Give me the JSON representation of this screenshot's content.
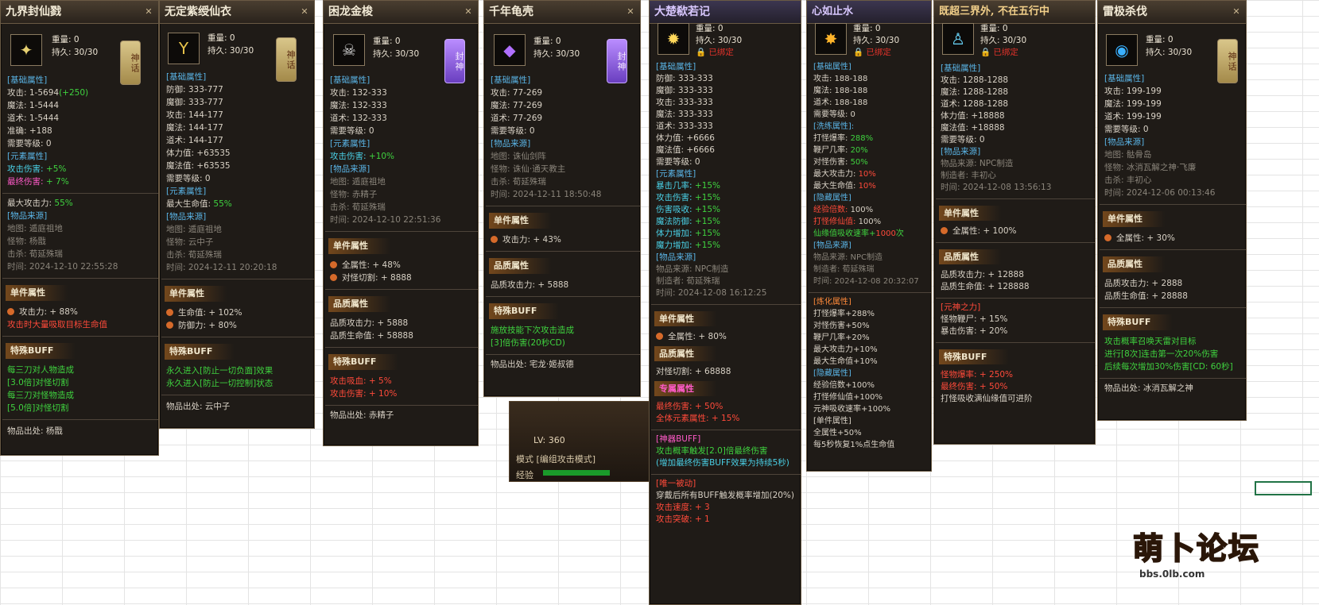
{
  "game": {
    "level": "LV: 360",
    "mode_label": "模式",
    "mode_value": "[编组攻击模式]",
    "exp_label": "经验"
  },
  "colors": {
    "panel_bg": "#1f1b17",
    "section": "#5ab4e6",
    "green": "#3fd23f",
    "red": "#ff4a3a",
    "magenta": "#ff5ac8"
  },
  "panels": [
    {
      "title": "九界封仙戮",
      "seal": "神话",
      "icon": "sword-icon",
      "weight": "重量: 0",
      "durability": "持久: 30/30",
      "lines": [
        [
          "[基础属性]"
        ],
        [
          "攻击: 1-5694",
          "(+250)"
        ],
        [
          "魔法: 1-5444"
        ],
        [
          "道术: 1-5444"
        ],
        [
          "准确: +188"
        ],
        [
          "需要等级: 0"
        ],
        [
          "[元素属性]"
        ],
        [
          "攻击伤害:",
          "+5%"
        ],
        [
          "最终伤害:",
          "+ 7%"
        ],
        [
          "最大攻击力:",
          "55%"
        ],
        [
          "[物品来源]"
        ],
        [
          "地图: 遁庭祖地"
        ],
        [
          "怪物: 杨戬"
        ],
        [
          "击杀: 荀延殊瑞"
        ],
        [
          "时间: 2024-12-10 22:55:28"
        ]
      ],
      "single_title": "单件属性",
      "single": [
        "攻击力: + 88%",
        "攻击时大量吸取目标生命值"
      ],
      "buff_title": "特殊BUFF",
      "buff": [
        "每三刀对人物造成",
        "[3.0倍]对怪切割",
        "每三刀对怪物造成",
        "[5.0倍]对怪切割"
      ],
      "source": "物品出处: 杨戬"
    },
    {
      "title": "无定紫绶仙衣",
      "seal": "神话",
      "icon": "robe-icon",
      "weight": "重量: 0",
      "durability": "持久: 30/30",
      "lines": [
        [
          "[基础属性]"
        ],
        [
          "防御: 333-777"
        ],
        [
          "魔御: 333-777"
        ],
        [
          "攻击: 144-177"
        ],
        [
          "魔法: 144-177"
        ],
        [
          "道术: 144-177"
        ],
        [
          "体力值: +63535"
        ],
        [
          "魔法值: +63535"
        ],
        [
          "需要等级: 0"
        ],
        [
          "[元素属性]"
        ],
        [
          "最大生命值:",
          "55%"
        ],
        [
          "[物品来源]"
        ],
        [
          "地图: 遁庭祖地"
        ],
        [
          "怪物: 云中子"
        ],
        [
          "击杀: 荀延殊瑞"
        ],
        [
          "时间: 2024-12-11 20:20:18"
        ]
      ],
      "single_title": "单件属性",
      "single": [
        "生命值: + 102%",
        "防御力: + 80%"
      ],
      "buff_title": "特殊BUFF",
      "buff": [
        "永久进入[防止一切负面]效果",
        "永久进入[防止一切控制]状态"
      ],
      "source": "物品出处: 云中子"
    },
    {
      "title": "困龙金梭",
      "seal": "封神",
      "icon": "skull-icon",
      "weight": "重量: 0",
      "durability": "持久: 30/30",
      "lines": [
        [
          "[基础属性]"
        ],
        [
          "攻击: 132-333"
        ],
        [
          "魔法: 132-333"
        ],
        [
          "道术: 132-333"
        ],
        [
          "需要等级: 0"
        ],
        [
          "[元素属性]"
        ],
        [
          "攻击伤害:",
          "+10%"
        ],
        [
          "[物品来源]"
        ],
        [
          "地图: 遁庭祖地"
        ],
        [
          "怪物: 赤精子"
        ],
        [
          "击杀: 荀延殊瑞"
        ],
        [
          "时间: 2024-12-10 22:51:36"
        ]
      ],
      "single_title": "单件属性",
      "single": [
        "全属性: + 48%",
        "对怪切割: + 8888"
      ],
      "quality_title": "品质属性",
      "quality": [
        "品质攻击力: + 5888",
        "品质生命值: + 58888"
      ],
      "buff_title": "特殊BUFF",
      "buff": [
        "攻击吸血: + 5%",
        "攻击伤害: + 10%"
      ],
      "source": "物品出处: 赤精子"
    },
    {
      "title": "千年龟壳",
      "seal": "封神",
      "icon": "shell-icon",
      "weight": "重量: 0",
      "durability": "持久: 30/30",
      "lines": [
        [
          "[基础属性]"
        ],
        [
          "攻击: 77-269"
        ],
        [
          "魔法: 77-269"
        ],
        [
          "道术: 77-269"
        ],
        [
          "需要等级: 0"
        ],
        [
          "[物品来源]"
        ],
        [
          "地图: 诛仙剑阵"
        ],
        [
          "怪物: 诛仙·通天教主"
        ],
        [
          "击杀: 荀延殊瑞"
        ],
        [
          "时间: 2024-12-11 18:50:48"
        ]
      ],
      "single_title": "单件属性",
      "single": [
        "攻击力: + 43%"
      ],
      "quality_title": "品质属性",
      "quality": [
        "品质攻击力: + 5888"
      ],
      "buff_title": "特殊BUFF",
      "buff": [
        "施放技能下次攻击造成",
        "[3]倍伤害(20秒CD)"
      ],
      "source": "物品出处: 宅龙·姬叔德"
    },
    {
      "title": "大楚欷若记",
      "icon": "sun-icon",
      "weight": "重量: 0",
      "durability": "持久: 30/30",
      "bound": "已绑定",
      "lines": [
        [
          "[基础属性]"
        ],
        [
          "防御: 333-333"
        ],
        [
          "魔御: 333-333"
        ],
        [
          "攻击: 333-333"
        ],
        [
          "魔法: 333-333"
        ],
        [
          "道术: 333-333"
        ],
        [
          "体力值: +6666"
        ],
        [
          "魔法值: +6666"
        ],
        [
          "需要等级: 0"
        ],
        [
          "[元素属性]"
        ],
        [
          "暴击几率:",
          "+15%"
        ],
        [
          "攻击伤害:",
          "+15%"
        ],
        [
          "伤害吸收:",
          "+15%"
        ],
        [
          "魔法防御:",
          "+15%"
        ],
        [
          "体力增加:",
          "+15%"
        ],
        [
          "魔力增加:",
          "+15%"
        ],
        [
          "[物品来源]"
        ],
        [
          "物品来源: NPC制造"
        ],
        [
          "制造者: 荀延殊瑞"
        ],
        [
          "时间: 2024-12-08 16:12:25"
        ]
      ],
      "single_title": "单件属性",
      "single": [
        "全属性: + 80%"
      ],
      "quality_title": "品质属性",
      "quality": [
        "对怪切割: + 68888"
      ],
      "exclusive_title": "专属属性",
      "exclusive": [
        "最终伤害: + 50%",
        "全体元素属性: + 15%"
      ],
      "artifact_title": "[神器BUFF]",
      "artifact": [
        "攻击概率触发[2.0]倍最终伤害",
        "(增加最终伤害BUFF效果为持续5秒)"
      ],
      "unique_title": "[唯一被动]",
      "unique": [
        "穿戴后所有BUFF触发概率增加(20%)",
        "攻击速度: + 3",
        "攻击突破: + 1"
      ]
    },
    {
      "title": "心如止水",
      "icon": "star-icon",
      "weight": "重量: 0",
      "durability": "持久: 30/30",
      "bound": "已绑定",
      "lines": [
        [
          "[基础属性]"
        ],
        [
          "攻击: 188-188"
        ],
        [
          "魔法: 188-188"
        ],
        [
          "道术: 188-188"
        ],
        [
          "需要等级: 0"
        ],
        [
          "[洗练属性]:"
        ],
        [
          "打怪爆率:",
          "288%"
        ],
        [
          "鞭尸几率:",
          "20%"
        ],
        [
          "对怪伤害:",
          "50%"
        ],
        [
          "最大攻击力:",
          "10%"
        ],
        [
          "最大生命值:",
          "10%"
        ],
        [
          "[隐藏属性]"
        ],
        [
          "经验倍数:",
          "100%"
        ],
        [
          "打怪修仙值:",
          "100%"
        ],
        [
          "仙缘值吸收速率+",
          "1000",
          "次"
        ],
        [
          "[物品来源]"
        ],
        [
          "物品来源: NPC制造"
        ],
        [
          "制造者: 荀延殊瑞"
        ],
        [
          "时间: 2024-12-08 20:32:07"
        ]
      ],
      "forge_title": "[炼化属性]",
      "forge": [
        "打怪爆率+288%",
        "对怪伤害+50%",
        "鞭尸几率+20%",
        "最大攻击力+10%",
        "最大生命值+10%"
      ],
      "hidden_title": "[隐藏属性]",
      "hidden": [
        "经验倍数+100%",
        "打怪修仙值+100%",
        "元神吸收速率+100%"
      ],
      "single_title": "[单件属性]",
      "single": [
        "全属性+50%",
        "每5秒恢复1%点生命值"
      ]
    },
    {
      "title": "既超三界外, 不在五行中",
      "icon": "figure-icon",
      "weight": "重量: 0",
      "durability": "持久: 30/30",
      "bound": "已绑定",
      "lines": [
        [
          "[基础属性]"
        ],
        [
          "攻击: 1288-1288"
        ],
        [
          "魔法: 1288-1288"
        ],
        [
          "道术: 1288-1288"
        ],
        [
          "体力值: +18888"
        ],
        [
          "魔法值: +18888"
        ],
        [
          "需要等级: 0"
        ],
        [
          "[物品来源]"
        ],
        [
          "物品来源: NPC制造"
        ],
        [
          "制造者: 丰初心"
        ],
        [
          "时间: 2024-12-08 13:56:13"
        ]
      ],
      "single_title": "单件属性",
      "single": [
        "全属性: + 100%"
      ],
      "quality_title": "品质属性",
      "quality": [
        "品质攻击力: + 12888",
        "品质生命值: + 128888"
      ],
      "yuanshen_title": "[元神之力]",
      "yuanshen": [
        "怪物鞭尸: + 15%",
        "暴击伤害: + 20%"
      ],
      "buff_title": "特殊BUFF",
      "buff": [
        "怪物爆率: + 250%",
        "最终伤害: + 50%",
        "打怪吸收满仙缘值可进阶"
      ]
    },
    {
      "title": "雷极杀伐",
      "seal": "神话",
      "icon": "thunder-orb-icon",
      "weight": "重量: 0",
      "durability": "持久: 30/30",
      "lines": [
        [
          "[基础属性]"
        ],
        [
          "攻击: 199-199"
        ],
        [
          "魔法: 199-199"
        ],
        [
          "道术: 199-199"
        ],
        [
          "需要等级: 0"
        ],
        [
          "[物品来源]"
        ],
        [
          "地图: 骷骨岛"
        ],
        [
          "怪物: 冰消瓦解之神·飞廉"
        ],
        [
          "击杀: 丰初心"
        ],
        [
          "时间: 2024-12-06 00:13:46"
        ]
      ],
      "single_title": "单件属性",
      "single": [
        "全属性: + 30%"
      ],
      "quality_title": "品质属性",
      "quality": [
        "品质攻击力: + 2888",
        "品质生命值: + 28888"
      ],
      "buff_title": "特殊BUFF",
      "buff": [
        "攻击概率召唤天雷对目标",
        "进行[8次]连击第一次20%伤害",
        "后续每次增加30%伤害[CD: 60秒]"
      ],
      "source": "物品出处: 冰消瓦解之神"
    }
  ],
  "logo": {
    "text": "萌卜论坛",
    "url": "bbs.0lb.com"
  }
}
